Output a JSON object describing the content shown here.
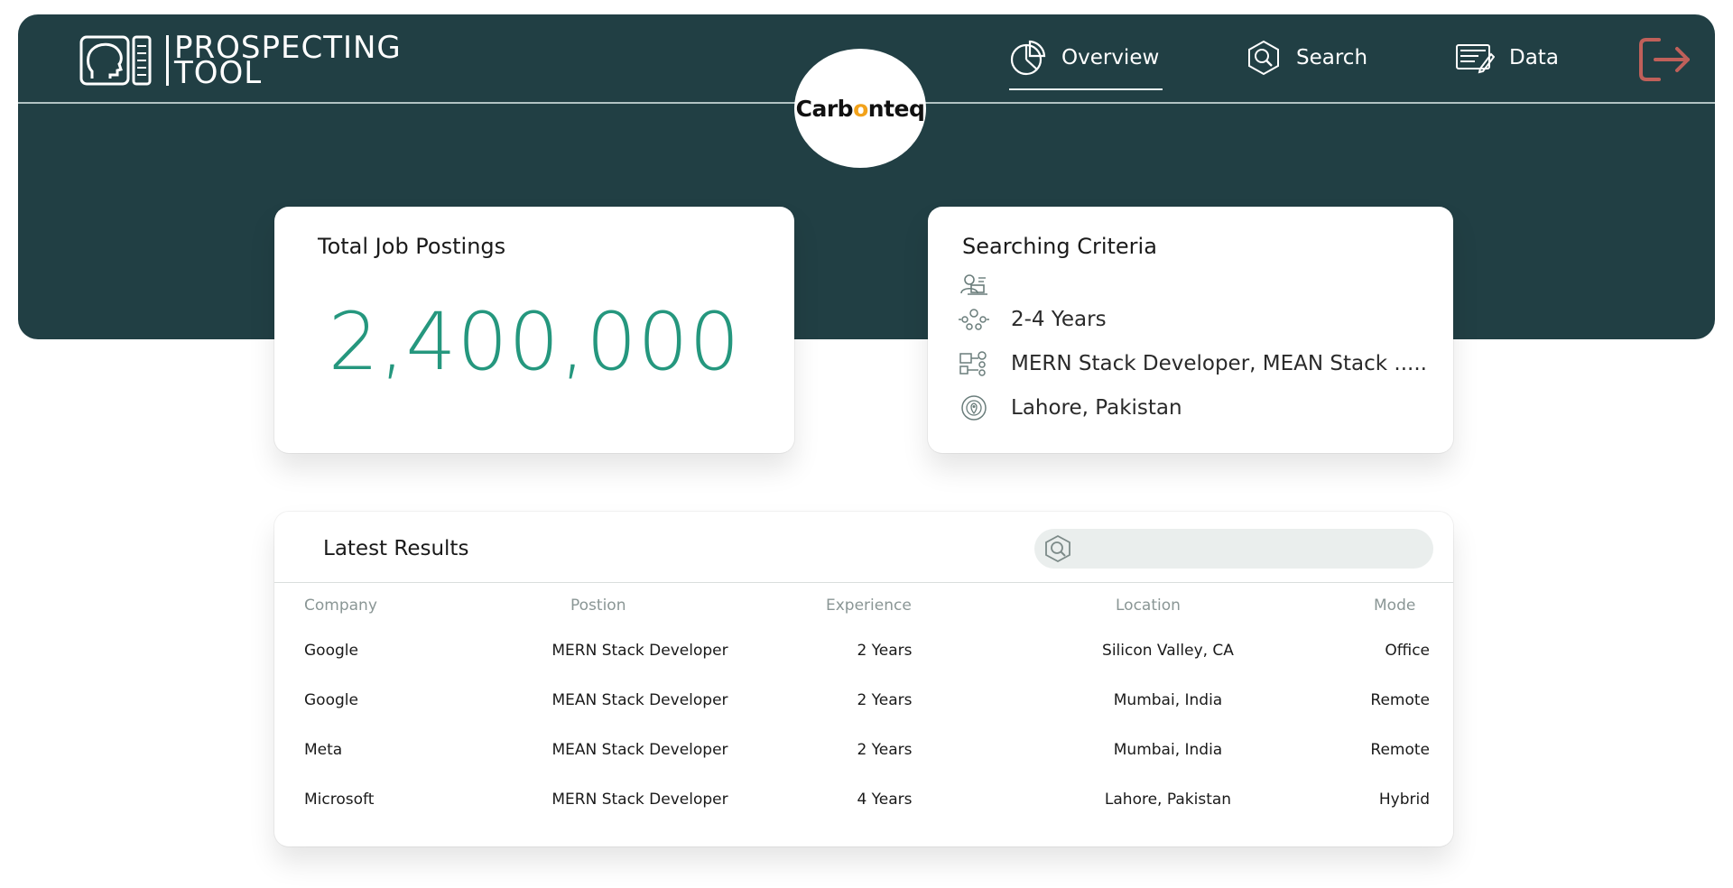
{
  "header": {
    "logo_line1": "PROSPECTING",
    "logo_line2": "TOOL",
    "brand": {
      "before": "Carb",
      "accent": "o",
      "after": "nteq"
    },
    "nav": [
      {
        "label": "Overview",
        "icon": "pie-chart-icon",
        "active": true
      },
      {
        "label": "Search",
        "icon": "search-icon",
        "active": false
      },
      {
        "label": "Data",
        "icon": "data-icon",
        "active": false
      }
    ],
    "logout_icon": "logout-icon"
  },
  "total_card": {
    "title": "Total Job Postings",
    "value": "2,400,000"
  },
  "criteria_card": {
    "title": "Searching Criteria",
    "rows": [
      {
        "icon": "person-laptop-icon",
        "text": ""
      },
      {
        "icon": "team-icon",
        "text": "2-4 Years"
      },
      {
        "icon": "job-role-icon",
        "text": "MERN Stack Developer, MEAN Stack ....."
      },
      {
        "icon": "location-icon",
        "text": "Lahore, Pakistan"
      }
    ]
  },
  "results": {
    "title": "Latest Results",
    "search_placeholder": "",
    "columns": [
      "Company",
      "Postion",
      "Experience",
      "Location",
      "Mode"
    ],
    "rows": [
      [
        "Google",
        "MERN Stack Developer",
        "2 Years",
        "Silicon Valley, CA",
        "Office"
      ],
      [
        "Google",
        "MEAN Stack Developer",
        "2 Years",
        "Mumbai, India",
        "Remote"
      ],
      [
        "Meta",
        "MEAN Stack Developer",
        "2 Years",
        "Mumbai, India",
        "Remote"
      ],
      [
        "Microsoft",
        "MERN Stack Developer",
        "4 Years",
        "Lahore, Pakistan",
        "Hybrid"
      ]
    ]
  },
  "colors": {
    "header_bg": "#213f44",
    "accent_green": "#25977e",
    "logout": "#c0605a",
    "brand_accent": "#f2a21b"
  }
}
